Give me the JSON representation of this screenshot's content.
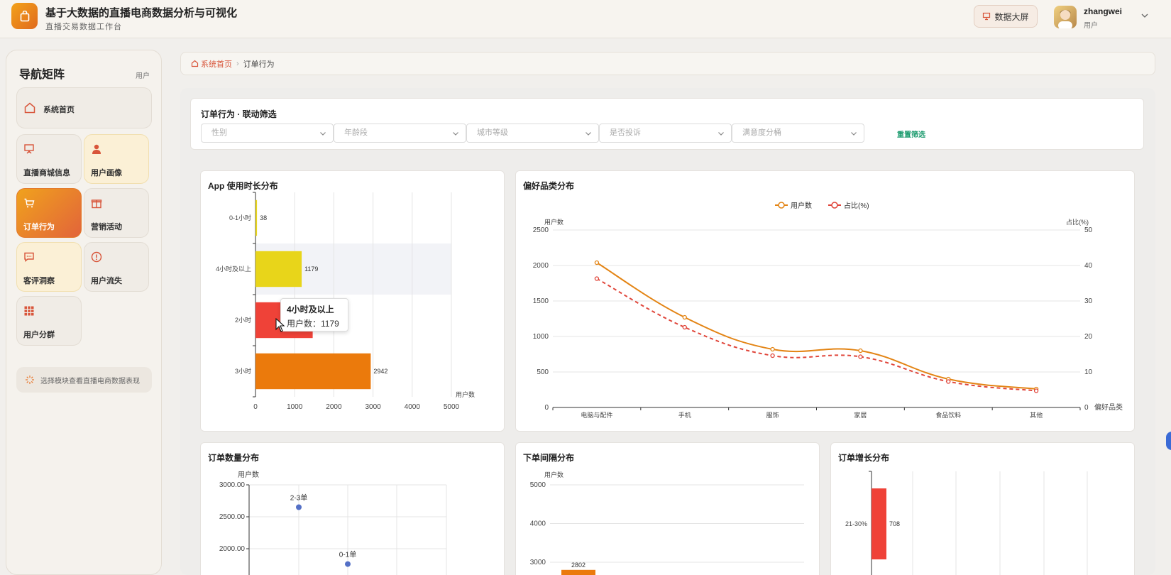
{
  "header": {
    "title": "基于大数据的直播电商数据分析与可视化",
    "subtitle": "直播交易数据工作台",
    "bigscreen_label": "数据大屏",
    "user_name": "zhangwei",
    "user_role": "用户"
  },
  "sidebar": {
    "title": "导航矩阵",
    "role": "用户",
    "items": [
      {
        "label": "系统首页",
        "icon": "home-icon"
      },
      {
        "label": "直播商城信息",
        "icon": "presentation-icon"
      },
      {
        "label": "用户画像",
        "icon": "user-icon"
      },
      {
        "label": "订单行为",
        "icon": "cart-icon",
        "active": true
      },
      {
        "label": "营销活动",
        "icon": "gift-icon"
      },
      {
        "label": "客评洞察",
        "icon": "comment-icon"
      },
      {
        "label": "用户流失",
        "icon": "alert-icon"
      },
      {
        "label": "用户分群",
        "icon": "grid-icon"
      }
    ],
    "hint": "选择模块查看直播电商数据表现"
  },
  "breadcrumb": {
    "home": "系统首页",
    "current": "订单行为"
  },
  "filter": {
    "title": "订单行为 · 联动筛选",
    "selects": [
      "性别",
      "年龄段",
      "城市等级",
      "是否投诉",
      "满意度分桶"
    ],
    "reset": "重置筛选"
  },
  "colors": {
    "accent": "#e8772e",
    "red": "#ef4238",
    "yellow": "#e8d51a",
    "orange": "#eb7a0c",
    "blue": "#5470c6",
    "green": "#1a9a6d"
  },
  "tooltip": {
    "title": "4小时及以上",
    "value": "用户数：1179"
  },
  "chart_data": [
    {
      "type": "bar",
      "title": "App 使用时长分布",
      "orientation": "horizontal",
      "categories": [
        "0-1小时",
        "4小时及以上",
        "2小时",
        "3小时"
      ],
      "values": [
        38,
        1179,
        1460,
        2942
      ],
      "labels": [
        "38",
        "1179",
        "",
        "2942"
      ],
      "colors": [
        "#e8d51a",
        "#e8d51a",
        "#ef4238",
        "#eb7a0c"
      ],
      "xlabel": "用户数",
      "xlim": [
        0,
        5000
      ],
      "ticks": [
        "0",
        "1000",
        "2000",
        "3000",
        "4000",
        "5000"
      ]
    },
    {
      "type": "line",
      "title": "偏好品类分布",
      "categories": [
        "电脑与配件",
        "手机",
        "服饰",
        "家居",
        "食品饮料",
        "其他"
      ],
      "series": [
        {
          "name": "用户数",
          "values": [
            2040,
            1270,
            820,
            800,
            400,
            260
          ],
          "axis": "left"
        },
        {
          "name": "占比(%)",
          "values": [
            36.3,
            22.6,
            14.6,
            14.3,
            7.3,
            4.7
          ],
          "axis": "right"
        }
      ],
      "ylabel_left": "用户数",
      "ylabel_right": "占比(%)",
      "xlabel": "偏好品类",
      "ylim_left": [
        0,
        2500
      ],
      "ylim_right": [
        0,
        50
      ],
      "left_ticks": [
        "0",
        "500",
        "1000",
        "1500",
        "2000",
        "2500"
      ],
      "right_ticks": [
        "0",
        "10",
        "20",
        "30",
        "40",
        "50"
      ],
      "legend": "top-center"
    },
    {
      "type": "scatter",
      "title": "订单数量分布",
      "ylabel": "用户数",
      "points": [
        {
          "label": "2-3单",
          "y": 2650
        },
        {
          "label": "0-1单",
          "y": 1760
        }
      ],
      "y_ticks": [
        "3000.00",
        "2500.00",
        "2000.00"
      ]
    },
    {
      "type": "bar",
      "title": "下单间隔分布",
      "ylabel": "用户数",
      "values": [
        2802
      ],
      "labels": [
        "2802"
      ],
      "y_ticks": [
        "5000",
        "4000",
        "3000"
      ]
    },
    {
      "type": "bar",
      "title": "订单增长分布",
      "orientation": "horizontal",
      "categories": [
        "21-30%"
      ],
      "values": [
        708
      ],
      "labels": [
        "708"
      ]
    }
  ]
}
